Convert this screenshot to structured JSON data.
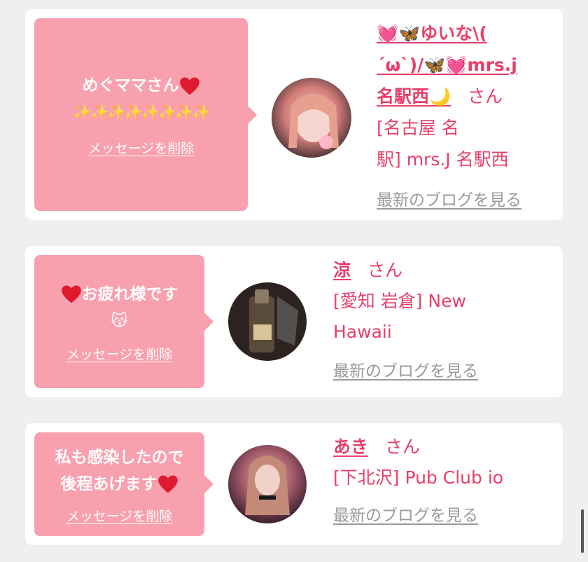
{
  "cards": [
    {
      "message_line1": "めぐママさん",
      "message_line2": "✨✨✨✨✨✨✨✨",
      "delete_label": "メッセージを削除",
      "name_line1": "💓🦋ゆいな\\(",
      "name_line2": "´ω`)/🦋💓mrs.j",
      "name_line3": "名駅西🌙",
      "san": "さん",
      "shop_line1": "[名古屋 名",
      "shop_line2": "駅] mrs.J 名駅西",
      "blog_label": "最新のブログを見る"
    },
    {
      "message_line1": "お疲れ様です",
      "message_line2": "😽",
      "delete_label": "メッセージを削除",
      "name": "涼",
      "san": "さん",
      "shop_line1": "[愛知 岩倉] New",
      "shop_line2": "Hawaii",
      "blog_label": "最新のブログを見る"
    },
    {
      "message_line1": "私も感染したので",
      "message_line2": "後程あげます",
      "delete_label": "メッセージを削除",
      "name": "あき",
      "san": "さん",
      "shop_line1": "[下北沢] Pub Club io",
      "blog_label": "最新のブログを見る"
    }
  ],
  "colors": {
    "accent": "#e83f6a",
    "bubble": "#f9a0ae",
    "background": "#efefef",
    "muted": "#9a9a9a"
  }
}
